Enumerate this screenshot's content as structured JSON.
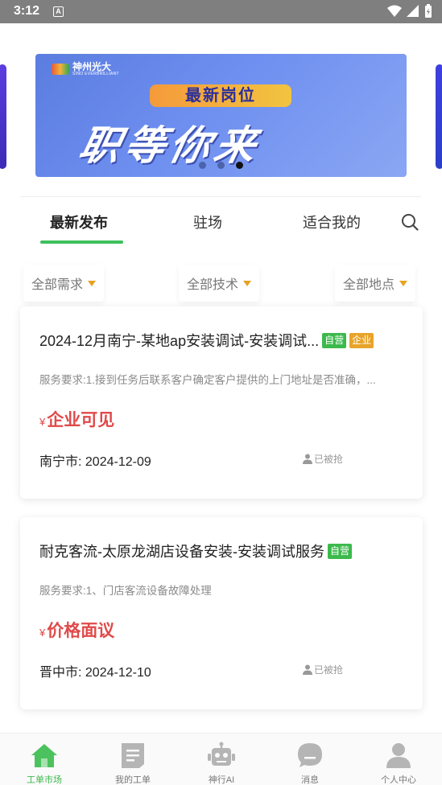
{
  "status_bar": {
    "time": "3:12",
    "notification_letter": "A"
  },
  "banner": {
    "brand_name": "神州光大",
    "brand_sub": "SINO EVERBRILLIANT",
    "pill_text": "最新岗位",
    "headline": "职等你来",
    "dots": 3,
    "active_dot": 3
  },
  "tabs": [
    {
      "label": "最新发布",
      "active": true
    },
    {
      "label": "驻场",
      "active": false
    },
    {
      "label": "适合我的",
      "active": false
    }
  ],
  "filters": [
    {
      "label": "全部需求"
    },
    {
      "label": "全部技术"
    },
    {
      "label": "全部地点"
    }
  ],
  "jobs": [
    {
      "title": "2024-12月南宁-某地ap安装调试-安装调试...",
      "badges": [
        "自营",
        "企业"
      ],
      "description": "服务要求:1.接到任务后联系客户确定客户提供的上门地址是否准确，...",
      "currency": "¥",
      "price": "企业可见",
      "location_date": "南宁市: 2024-12-09",
      "status": "已被抢"
    },
    {
      "title": "耐克客流-太原龙湖店设备安装-安装调试服务",
      "badges": [
        "自营"
      ],
      "description": "服务要求:1、门店客流设备故障处理",
      "currency": "¥",
      "price": "价格面议",
      "location_date": "晋中市: 2024-12-10",
      "status": "已被抢"
    }
  ],
  "bottom_nav": [
    {
      "label": "工单市场",
      "icon": "home-icon",
      "active": true
    },
    {
      "label": "我的工单",
      "icon": "orders-icon",
      "active": false
    },
    {
      "label": "神行AI",
      "icon": "robot-icon",
      "active": false
    },
    {
      "label": "消息",
      "icon": "message-icon",
      "active": false
    },
    {
      "label": "个人中心",
      "icon": "user-icon",
      "active": false
    }
  ],
  "colors": {
    "accent": "#3dc05a",
    "price": "#e04a4a",
    "badge_green": "#3cb94c",
    "badge_orange": "#e8a42a",
    "filter_arrow": "#e6a321"
  }
}
